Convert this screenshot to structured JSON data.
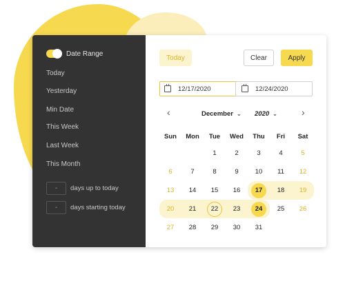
{
  "sidebar": {
    "toggle_label": "Date Range",
    "presets": [
      "Today",
      "Yesterday",
      "Min Date",
      "This Week",
      "Last Week",
      "This Month"
    ],
    "days_up_to_today": {
      "value": "-",
      "label": "days up to today"
    },
    "days_starting_today": {
      "value": "-",
      "label": "days starting today"
    }
  },
  "toolbar": {
    "today_label": "Today",
    "clear_label": "Clear",
    "apply_label": "Apply"
  },
  "range": {
    "start": "12/17/2020",
    "end": "12/24/2020"
  },
  "calendar": {
    "month": "December",
    "year": "2020",
    "weekdays": [
      "Sun",
      "Mon",
      "Tue",
      "Wed",
      "Thu",
      "Fri",
      "Sat"
    ],
    "weeks": [
      [
        "",
        "",
        "1",
        "2",
        "3",
        "4",
        "5"
      ],
      [
        "6",
        "7",
        "8",
        "9",
        "10",
        "11",
        "12"
      ],
      [
        "13",
        "14",
        "15",
        "16",
        "17",
        "18",
        "19"
      ],
      [
        "20",
        "21",
        "22",
        "23",
        "24",
        "25",
        "26"
      ],
      [
        "27",
        "28",
        "29",
        "30",
        "31",
        "",
        ""
      ]
    ],
    "range_start_day": 17,
    "range_end_day": 24,
    "today_day": 22
  },
  "colors": {
    "accent": "#f6d94f",
    "accent_light": "#fcf3cf",
    "sidebar_bg": "#333333"
  }
}
